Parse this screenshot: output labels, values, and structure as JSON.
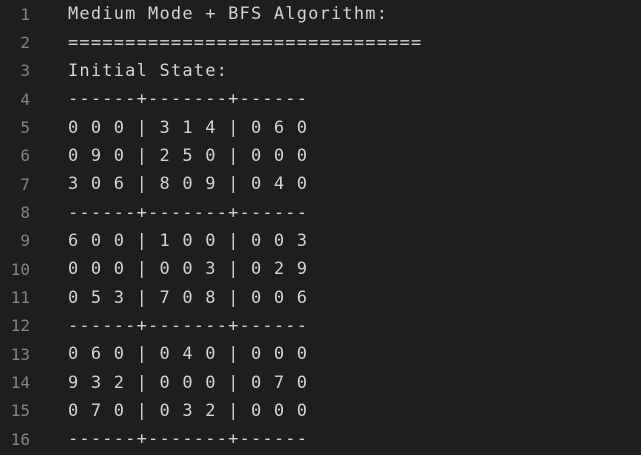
{
  "editor": {
    "lines": [
      {
        "number": "1",
        "text": "Medium Mode + BFS Algorithm:"
      },
      {
        "number": "2",
        "text": "==============================="
      },
      {
        "number": "3",
        "text": "Initial State:"
      },
      {
        "number": "4",
        "text": "------+-------+------"
      },
      {
        "number": "5",
        "text": "0 0 0 | 3 1 4 | 0 6 0"
      },
      {
        "number": "6",
        "text": "0 9 0 | 2 5 0 | 0 0 0"
      },
      {
        "number": "7",
        "text": "3 0 6 | 8 0 9 | 0 4 0"
      },
      {
        "number": "8",
        "text": "------+-------+------"
      },
      {
        "number": "9",
        "text": "6 0 0 | 1 0 0 | 0 0 3"
      },
      {
        "number": "10",
        "text": "0 0 0 | 0 0 3 | 0 2 9"
      },
      {
        "number": "11",
        "text": "0 5 3 | 7 0 8 | 0 0 6"
      },
      {
        "number": "12",
        "text": "------+-------+------"
      },
      {
        "number": "13",
        "text": "0 6 0 | 0 4 0 | 0 0 0"
      },
      {
        "number": "14",
        "text": "9 3 2 | 0 0 0 | 0 7 0"
      },
      {
        "number": "15",
        "text": "0 7 0 | 0 3 2 | 0 0 0"
      },
      {
        "number": "16",
        "text": "------+-------+------"
      }
    ]
  }
}
